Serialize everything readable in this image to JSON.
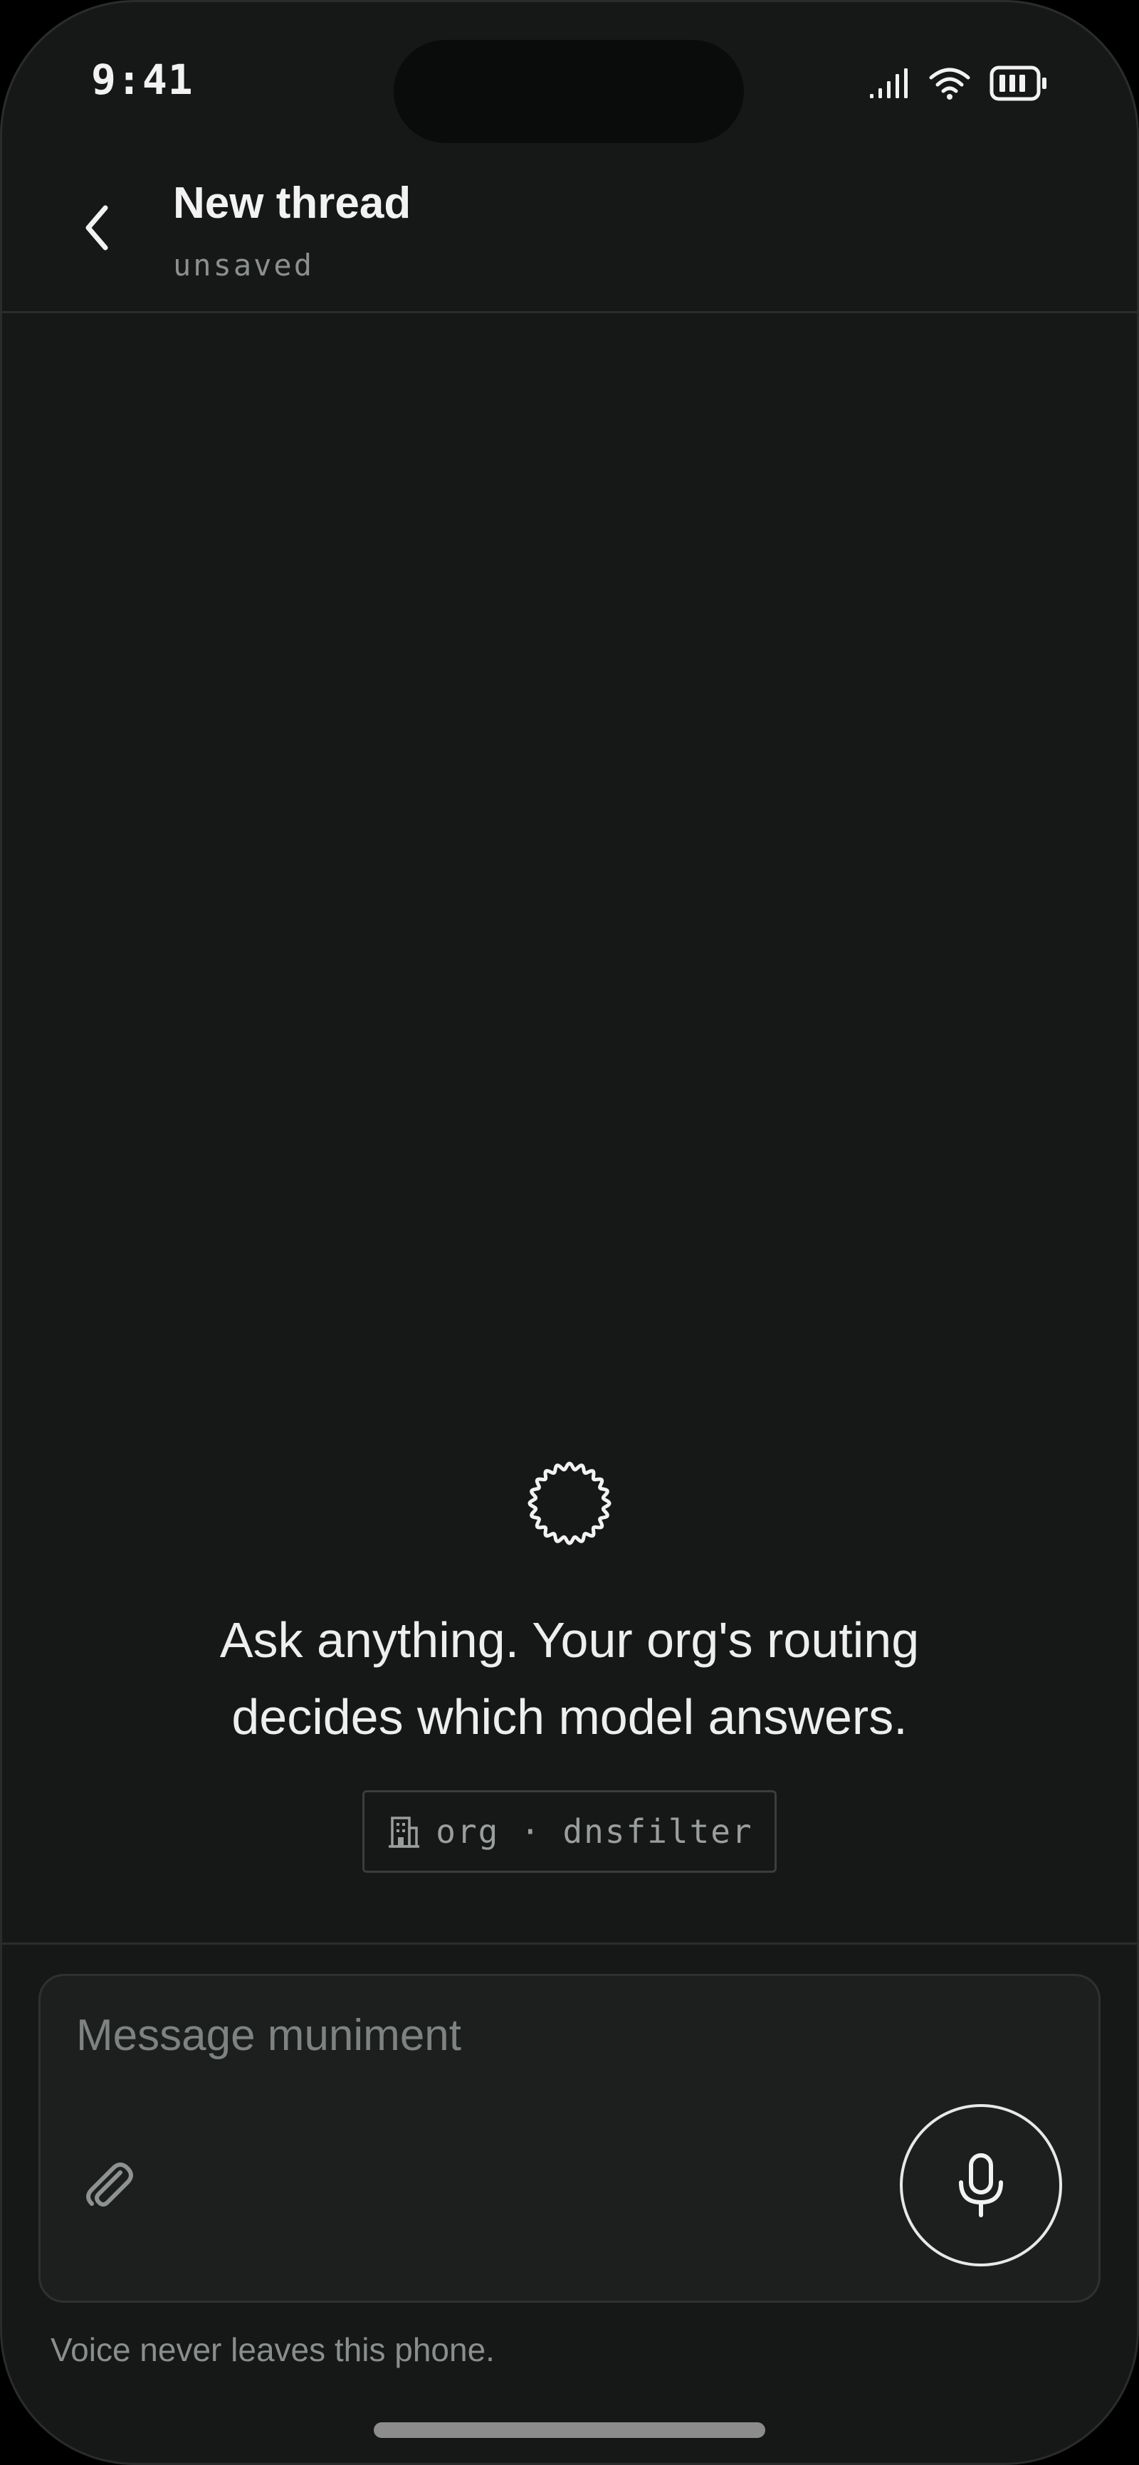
{
  "status_bar": {
    "time": "9:41",
    "icons": [
      "cellular-signal-icon",
      "wifi-icon",
      "battery-icon"
    ]
  },
  "header": {
    "back_icon": "chevron-left-icon",
    "title": "New thread",
    "subtitle": "unsaved"
  },
  "empty_state": {
    "spinner_icon": "loading-ring-icon",
    "message_line1": "Ask anything. Your org's routing",
    "message_line2": "decides which model answers.",
    "org_badge": {
      "icon": "building-icon",
      "label": "org · dnsfilter"
    }
  },
  "composer": {
    "placeholder": "Message muniment",
    "value": "",
    "attach_icon": "paperclip-icon",
    "mic_icon": "microphone-icon"
  },
  "footer": {
    "privacy_note": "Voice never leaves this phone."
  },
  "colors": {
    "background": "#161817",
    "text_primary": "#f2f2f2",
    "text_muted": "#8b8f8d",
    "border": "#2b2d2c",
    "composer_bg": "#1c1f1e"
  }
}
